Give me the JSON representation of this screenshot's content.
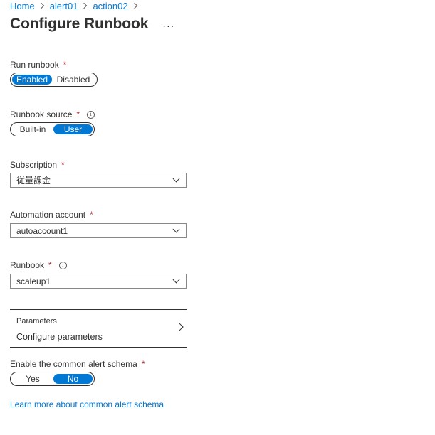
{
  "breadcrumb": [
    {
      "label": "Home"
    },
    {
      "label": "alert01"
    },
    {
      "label": "action02"
    }
  ],
  "header": {
    "title": "Configure Runbook",
    "more_label": "···"
  },
  "run_runbook": {
    "label": "Run runbook",
    "required": "*",
    "options": [
      "Enabled",
      "Disabled"
    ],
    "selected": "Enabled"
  },
  "runbook_source": {
    "label": "Runbook source",
    "required": "*",
    "info": "i",
    "options": [
      "Built-in",
      "User"
    ],
    "selected": "User"
  },
  "subscription": {
    "label": "Subscription",
    "required": "*",
    "value": "従量課金"
  },
  "automation_account": {
    "label": "Automation account",
    "required": "*",
    "value": "autoaccount1"
  },
  "runbook": {
    "label": "Runbook",
    "required": "*",
    "info": "i",
    "value": "scaleup1"
  },
  "parameters": {
    "title": "Parameters",
    "subtitle": "Configure parameters"
  },
  "common_alert_schema": {
    "label": "Enable the common alert schema",
    "required": "*",
    "options": [
      "Yes",
      "No"
    ],
    "selected": "No"
  },
  "learn_more": {
    "label": "Learn more about common alert schema"
  },
  "colors": {
    "accent": "#0078d4",
    "required": "#a4262c",
    "text": "#323130"
  }
}
